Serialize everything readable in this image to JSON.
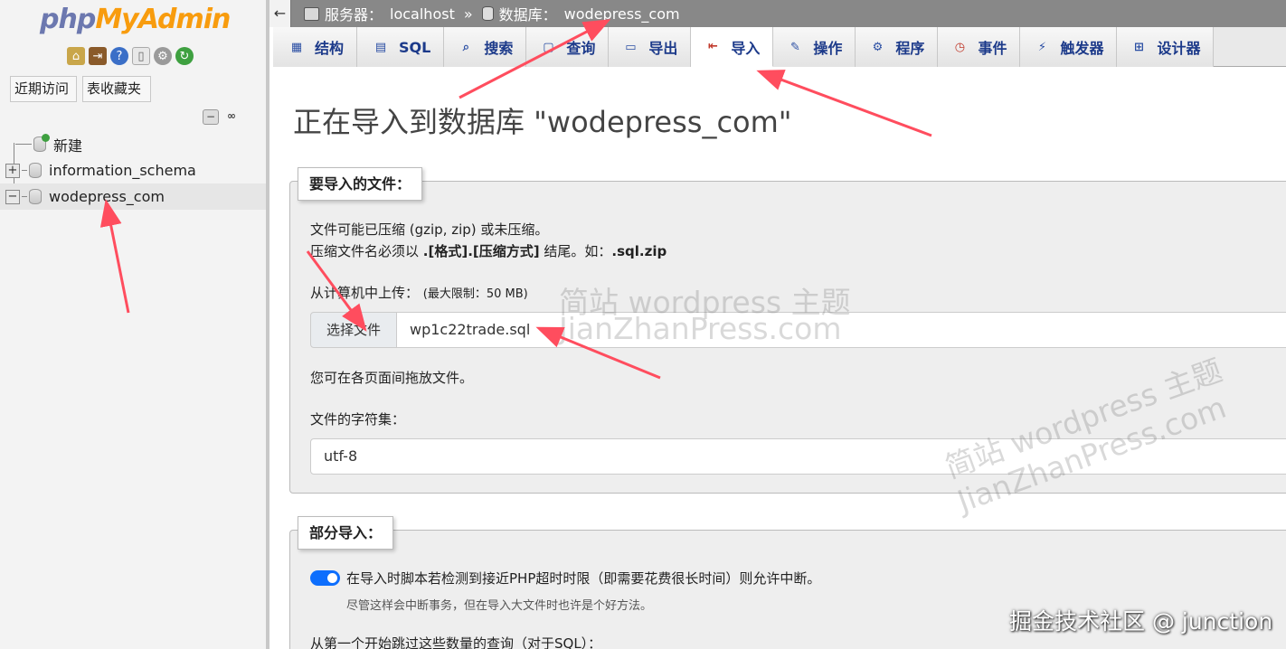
{
  "nav": {
    "logo_php": "php",
    "logo_myadmin": "MyAdmin",
    "icons": [
      "home-icon",
      "exit-icon",
      "help-icon",
      "docs-icon",
      "settings-icon",
      "reload-icon"
    ],
    "recent_label": "近期访问",
    "favorites_label": "表收藏夹",
    "tree": [
      {
        "label": "新建",
        "expander": ""
      },
      {
        "label": "information_schema",
        "expander": "+"
      },
      {
        "label": "wodepress_com",
        "expander": "−",
        "selected": true
      }
    ]
  },
  "breadcrumb": {
    "server_label": "服务器：",
    "server_value": "localhost",
    "separator": "»",
    "db_label": "数据库：",
    "db_value": "wodepress_com"
  },
  "tabs": [
    {
      "label": "结构",
      "icon": "structure-icon"
    },
    {
      "label": "SQL",
      "icon": "sql-icon"
    },
    {
      "label": "搜索",
      "icon": "search-icon"
    },
    {
      "label": "查询",
      "icon": "query-icon"
    },
    {
      "label": "导出",
      "icon": "export-icon"
    },
    {
      "label": "导入",
      "icon": "import-icon",
      "active": true
    },
    {
      "label": "操作",
      "icon": "wrench-icon"
    },
    {
      "label": "程序",
      "icon": "routines-icon"
    },
    {
      "label": "事件",
      "icon": "events-icon"
    },
    {
      "label": "触发器",
      "icon": "triggers-icon"
    },
    {
      "label": "设计器",
      "icon": "designer-icon"
    }
  ],
  "main": {
    "title": "正在导入到数据库 \"wodepress_com\"",
    "file_section": {
      "legend": "要导入的文件：",
      "line1": "文件可能已压缩 (gzip, zip) 或未压缩。",
      "line2_prefix": "压缩文件名必须以 ",
      "line2_bold": ".[格式].[压缩方式]",
      "line2_mid": " 结尾。如：",
      "line2_example": ".sql.zip",
      "upload_label": "从计算机中上传：",
      "upload_limit": "(最大限制：50 MB)",
      "choose_button": "选择文件",
      "file_value": "wp1c22trade.sql",
      "drag_hint": "您可在各页面间拖放文件。",
      "charset_label": "文件的字符集：",
      "charset_value": "utf-8"
    },
    "partial_section": {
      "legend": "部分导入：",
      "interrupt_label": "在导入时脚本若检测到接近PHP超时时限（即需要花费很长时间）则允许中断。",
      "interrupt_hint": "尽管这样会中断事务，但在导入大文件时也许是个好方法。",
      "interrupt_enabled": true,
      "skip_label": "从第一个开始跳过这些数量的查询（对于SQL）："
    }
  },
  "watermark": {
    "line1": "简站 wordpress 主题",
    "line2": "JianZhanPress.com"
  },
  "credit": "掘金技术社区 @ junction",
  "colors": {
    "topbar": "#888888",
    "tab_text": "#1c3a8a",
    "toggle": "#0d6efd",
    "annotation": "#ff4d5e",
    "logo_php": "#6c78af",
    "logo_myadmin": "#f89c0e"
  }
}
